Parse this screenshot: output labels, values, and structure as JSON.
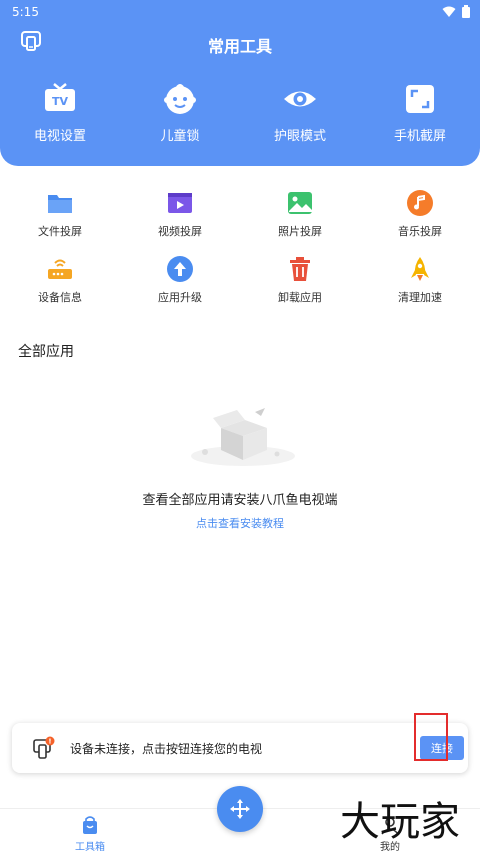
{
  "status_bar": {
    "time": "5:15"
  },
  "header": {
    "title": "常用工具",
    "top_tools": [
      {
        "label": "电视设置",
        "icon": "tv-icon"
      },
      {
        "label": "儿童锁",
        "icon": "child-face-icon"
      },
      {
        "label": "护眼模式",
        "icon": "eye-icon"
      },
      {
        "label": "手机截屏",
        "icon": "screenshot-icon"
      }
    ]
  },
  "tools_grid": [
    {
      "label": "文件投屏",
      "icon": "folder-icon",
      "color": "#4a8cf0"
    },
    {
      "label": "视频投屏",
      "icon": "video-icon",
      "color": "#7b57e8"
    },
    {
      "label": "照片投屏",
      "icon": "photo-icon",
      "color": "#3cc26e"
    },
    {
      "label": "音乐投屏",
      "icon": "music-icon",
      "color": "#f57c2a"
    },
    {
      "label": "设备信息",
      "icon": "router-icon",
      "color": "#f5a623"
    },
    {
      "label": "应用升级",
      "icon": "upgrade-icon",
      "color": "#4a8cf0"
    },
    {
      "label": "卸载应用",
      "icon": "trash-icon",
      "color": "#e8503a"
    },
    {
      "label": "清理加速",
      "icon": "rocket-icon",
      "color": "#f5b400"
    }
  ],
  "all_apps": {
    "title": "全部应用",
    "empty_text": "查看全部应用请安装八爪鱼电视端",
    "tutorial_link": "点击查看安装教程"
  },
  "connection_banner": {
    "text": "设备未连接，点击按钮连接您的电视",
    "button": "连接",
    "badge": "!"
  },
  "bottom_nav": {
    "tools_label": "工具箱",
    "mine_label": "我的"
  },
  "watermark": {
    "text": "大玩家"
  },
  "colors": {
    "primary": "#5b93f5",
    "accent": "#4a8cf0",
    "highlight": "#e32c2c"
  }
}
